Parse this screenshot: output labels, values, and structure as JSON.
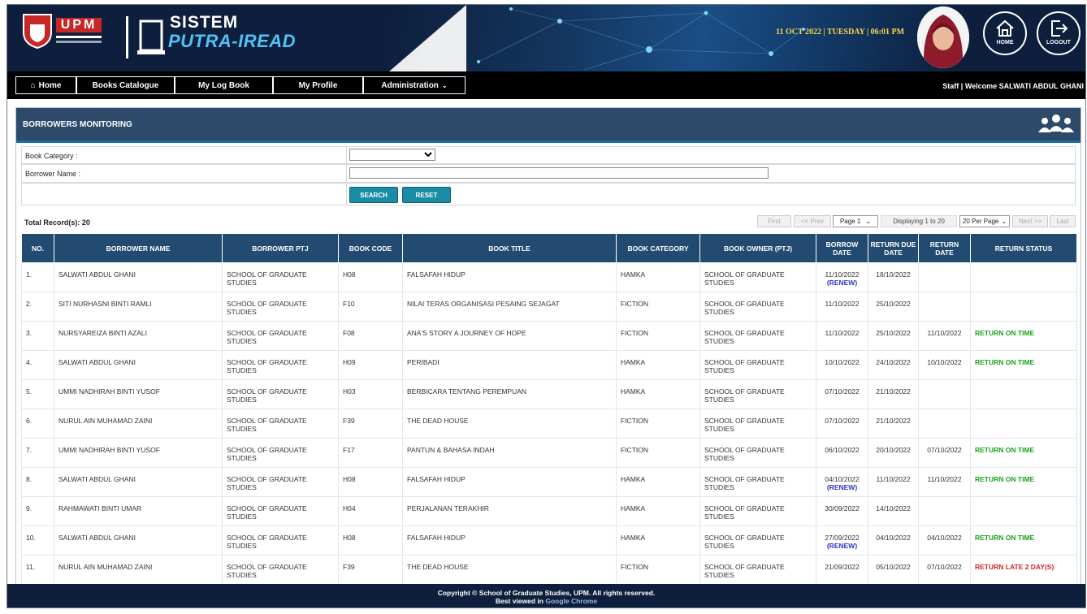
{
  "header": {
    "upm_text": "UPM",
    "system_line1": "SISTEM",
    "system_line2": "PUTRA-IREAD",
    "datetime": "11 OCT 2022 | TUESDAY | 06:01 PM",
    "home_label": "HOME",
    "logout_label": "LOGOUT"
  },
  "nav": {
    "items": [
      {
        "label": "Home",
        "icon": "home-icon"
      },
      {
        "label": "Books Catalogue"
      },
      {
        "label": "My Log Book"
      },
      {
        "label": "My Profile"
      },
      {
        "label": "Administration",
        "icon": "chevron-down-icon"
      }
    ],
    "welcome": "Staff  |  Welcome SALWATI ABDUL GHANI"
  },
  "panel": {
    "title": "BORROWERS MONITORING",
    "icon": "users-icon"
  },
  "filter": {
    "category_label": "Book Category :",
    "category_value": "",
    "borrower_label": "Borrower Name :",
    "borrower_value": "",
    "search_label": "SEARCH",
    "reset_label": "RESET"
  },
  "pager": {
    "total": "Total Record(s): 20",
    "first": "First",
    "prev": "<< Prev",
    "page": "Page 1",
    "displaying": "Displaying 1 to 20",
    "per_page": "20 Per Page",
    "next": "Next >>",
    "last": "Last"
  },
  "table": {
    "headers": [
      "NO.",
      "BORROWER NAME",
      "BORROWER PTJ",
      "BOOK CODE",
      "BOOK TITLE",
      "BOOK CATEGORY",
      "BOOK OWNER (PTJ)",
      "BORROW DATE",
      "RETURN DUE DATE",
      "RETURN DATE",
      "RETURN STATUS"
    ],
    "rows": [
      {
        "no": "1.",
        "name": "SALWATI ABDUL GHANI",
        "ptj": "SCHOOL OF GRADUATE STUDIES",
        "code": "H08",
        "title": "FALSAFAH HIDUP",
        "category": "HAMKA",
        "owner": "SCHOOL OF GRADUATE STUDIES",
        "borrow": "11/10/2022",
        "renew": "(RENEW)",
        "due": "18/10/2022",
        "ret": "",
        "status": "",
        "status_type": ""
      },
      {
        "no": "2.",
        "name": "SITI NURHASNI BINTI RAMLI",
        "ptj": "SCHOOL OF GRADUATE STUDIES",
        "code": "F10",
        "title": "NILAI TERAS ORGANISASI PESAING SEJAGAT",
        "category": "FICTION",
        "owner": "SCHOOL OF GRADUATE STUDIES",
        "borrow": "11/10/2022",
        "renew": "",
        "due": "25/10/2022",
        "ret": "",
        "status": "",
        "status_type": ""
      },
      {
        "no": "3.",
        "name": "NURSYAREIZA BINTI AZALI",
        "ptj": "SCHOOL OF GRADUATE STUDIES",
        "code": "F08",
        "title": "ANA'S STORY A JOURNEY OF HOPE",
        "category": "FICTION",
        "owner": "SCHOOL OF GRADUATE STUDIES",
        "borrow": "11/10/2022",
        "renew": "",
        "due": "25/10/2022",
        "ret": "11/10/2022",
        "status": "RETURN ON TIME",
        "status_type": "ok"
      },
      {
        "no": "4.",
        "name": "SALWATI ABDUL GHANI",
        "ptj": "SCHOOL OF GRADUATE STUDIES",
        "code": "H09",
        "title": "PERIBADI",
        "category": "HAMKA",
        "owner": "SCHOOL OF GRADUATE STUDIES",
        "borrow": "10/10/2022",
        "renew": "",
        "due": "24/10/2022",
        "ret": "10/10/2022",
        "status": "RETURN ON TIME",
        "status_type": "ok"
      },
      {
        "no": "5.",
        "name": "UMMI NADHIRAH BINTI YUSOF",
        "ptj": "SCHOOL OF GRADUATE STUDIES",
        "code": "H03",
        "title": "BERBICARA TENTANG PEREMPUAN",
        "category": "HAMKA",
        "owner": "SCHOOL OF GRADUATE STUDIES",
        "borrow": "07/10/2022",
        "renew": "",
        "due": "21/10/2022",
        "ret": "",
        "status": "",
        "status_type": ""
      },
      {
        "no": "6.",
        "name": "NURUL AIN MUHAMAD ZAINI",
        "ptj": "SCHOOL OF GRADUATE STUDIES",
        "code": "F39",
        "title": "THE DEAD HOUSE",
        "category": "FICTION",
        "owner": "SCHOOL OF GRADUATE STUDIES",
        "borrow": "07/10/2022",
        "renew": "",
        "due": "21/10/2022",
        "ret": "",
        "status": "",
        "status_type": ""
      },
      {
        "no": "7.",
        "name": "UMMI NADHIRAH BINTI YUSOF",
        "ptj": "SCHOOL OF GRADUATE STUDIES",
        "code": "F17",
        "title": "PANTUN & BAHASA INDAH",
        "category": "FICTION",
        "owner": "SCHOOL OF GRADUATE STUDIES",
        "borrow": "06/10/2022",
        "renew": "",
        "due": "20/10/2022",
        "ret": "07/10/2022",
        "status": "RETURN ON TIME",
        "status_type": "ok"
      },
      {
        "no": "8.",
        "name": "SALWATI ABDUL GHANI",
        "ptj": "SCHOOL OF GRADUATE STUDIES",
        "code": "H08",
        "title": "FALSAFAH HIDUP",
        "category": "HAMKA",
        "owner": "SCHOOL OF GRADUATE STUDIES",
        "borrow": "04/10/2022",
        "renew": "(RENEW)",
        "due": "11/10/2022",
        "ret": "11/10/2022",
        "status": "RETURN ON TIME",
        "status_type": "ok"
      },
      {
        "no": "9.",
        "name": "RAHMAWATI BINTI UMAR",
        "ptj": "SCHOOL OF GRADUATE STUDIES",
        "code": "H04",
        "title": "PERJALANAN TERAKHIR",
        "category": "HAMKA",
        "owner": "SCHOOL OF GRADUATE STUDIES",
        "borrow": "30/09/2022",
        "renew": "",
        "due": "14/10/2022",
        "ret": "",
        "status": "",
        "status_type": ""
      },
      {
        "no": "10.",
        "name": "SALWATI ABDUL GHANI",
        "ptj": "SCHOOL OF GRADUATE STUDIES",
        "code": "H08",
        "title": "FALSAFAH HIDUP",
        "category": "HAMKA",
        "owner": "SCHOOL OF GRADUATE STUDIES",
        "borrow": "27/09/2022",
        "renew": "(RENEW)",
        "due": "04/10/2022",
        "ret": "04/10/2022",
        "status": "RETURN ON TIME",
        "status_type": "ok"
      },
      {
        "no": "11.",
        "name": "NURUL AIN MUHAMAD ZAINI",
        "ptj": "SCHOOL OF GRADUATE STUDIES",
        "code": "F39",
        "title": "THE DEAD HOUSE",
        "category": "FICTION",
        "owner": "SCHOOL OF GRADUATE STUDIES",
        "borrow": "21/09/2022",
        "renew": "",
        "due": "05/10/2022",
        "ret": "07/10/2022",
        "status": "RETURN LATE 2 DAY(S)",
        "status_type": "late"
      }
    ]
  },
  "footer": {
    "line1": "Copyright © School of Graduate Studies, UPM. All rights reserved.",
    "line2_prefix": "Best viewed in ",
    "line2_browser": "Google Chrome"
  },
  "colors": {
    "header_bg": "#0d1f3c",
    "table_header": "#234b72",
    "button": "#1b8ca6",
    "status_ok": "#1aa31a",
    "status_late": "#d32222",
    "renew": "#2a35c9"
  }
}
